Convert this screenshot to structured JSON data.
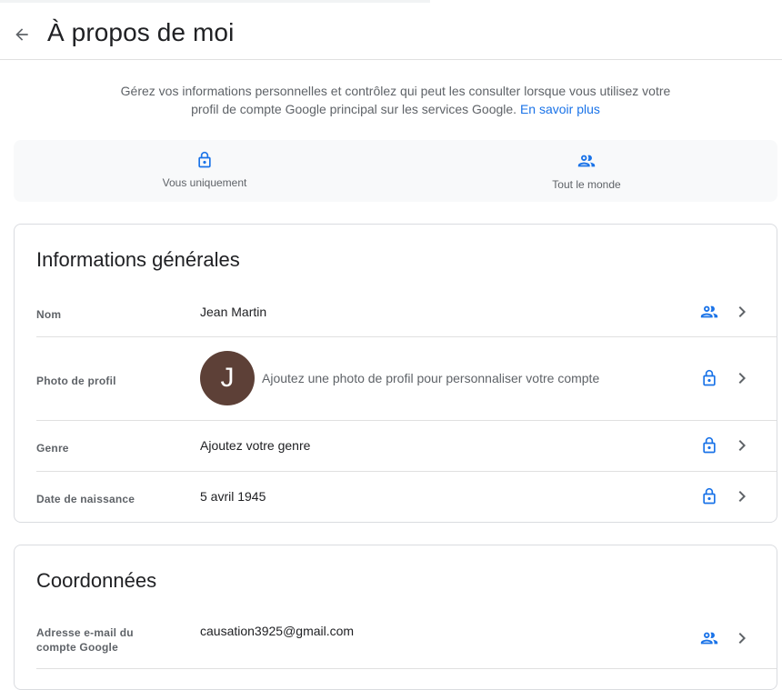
{
  "header": {
    "title": "À propos de moi",
    "back_icon": "arrow-back-icon"
  },
  "loading_progress": 0.55,
  "intro": {
    "text": "Gérez vos informations personnelles et contrôlez qui peut les consulter lorsque vous utilisez votre profil de compte Google principal sur les services Google.",
    "link": "En savoir plus"
  },
  "visibility_legend": [
    {
      "label": "Vous uniquement",
      "icon": "lock-icon"
    },
    {
      "label": "Tout le monde",
      "icon": "people-icon"
    }
  ],
  "general_info": {
    "title": "Informations générales",
    "rows": {
      "name": {
        "label": "Nom",
        "value": "Jean Martin",
        "visibility": "people-icon"
      },
      "photo": {
        "label": "Photo de profil",
        "avatar_letter": "J",
        "hint": "Ajoutez une photo de profil pour personnaliser votre compte",
        "visibility": "lock-icon"
      },
      "gender": {
        "label": "Genre",
        "value": "Ajoutez votre genre",
        "visibility": "lock-icon"
      },
      "birthday": {
        "label": "Date de naissance",
        "value": "5 avril 1945",
        "visibility": "lock-icon"
      }
    }
  },
  "contact_info": {
    "title": "Coordonnées",
    "rows": {
      "email": {
        "label": "Adresse e-mail du compte Google",
        "value": "causation3925@gmail.com",
        "visibility": "people-icon"
      }
    }
  },
  "colors": {
    "accent": "#1a73e8",
    "avatar_bg": "#5d4037",
    "text_secondary": "#5f6368"
  }
}
